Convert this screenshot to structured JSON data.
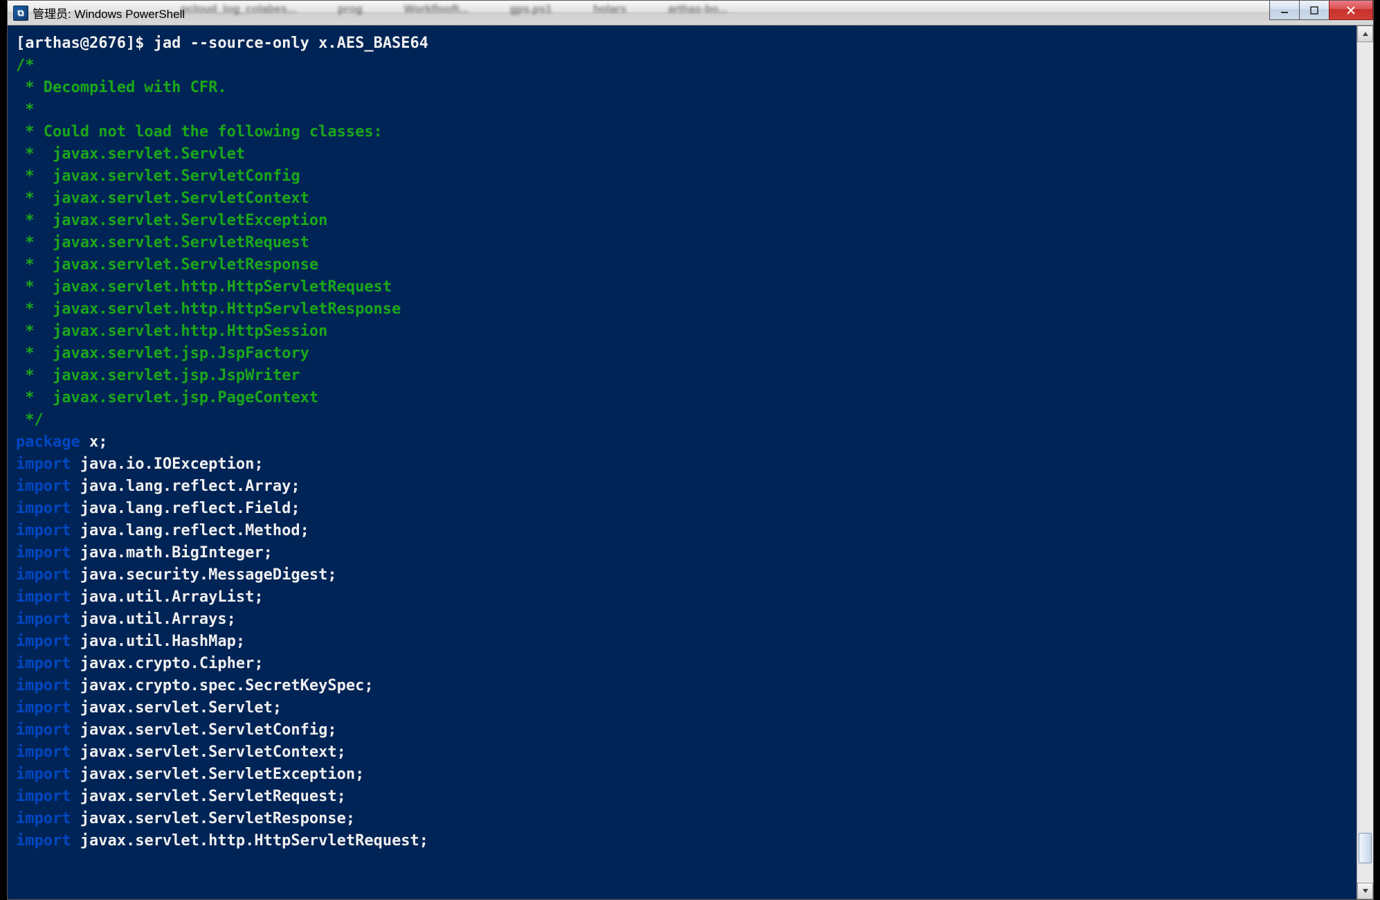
{
  "window": {
    "title": "管理员: Windows PowerShell",
    "icon_glyph": "⧉"
  },
  "prompt": {
    "text": "[arthas@2676]$ ",
    "command": "jad --source-only x.AES_BASE64"
  },
  "comment_block": [
    "/*",
    " * Decompiled with CFR.",
    " *",
    " * Could not load the following classes:",
    " *  javax.servlet.Servlet",
    " *  javax.servlet.ServletConfig",
    " *  javax.servlet.ServletContext",
    " *  javax.servlet.ServletException",
    " *  javax.servlet.ServletRequest",
    " *  javax.servlet.ServletResponse",
    " *  javax.servlet.http.HttpServletRequest",
    " *  javax.servlet.http.HttpServletResponse",
    " *  javax.servlet.http.HttpSession",
    " *  javax.servlet.jsp.JspFactory",
    " *  javax.servlet.jsp.JspWriter",
    " *  javax.servlet.jsp.PageContext",
    " */"
  ],
  "package_line": {
    "keyword": "package",
    "rest": " x;"
  },
  "imports": [
    "java.io.IOException;",
    "java.lang.reflect.Array;",
    "java.lang.reflect.Field;",
    "java.lang.reflect.Method;",
    "java.math.BigInteger;",
    "java.security.MessageDigest;",
    "java.util.ArrayList;",
    "java.util.Arrays;",
    "java.util.HashMap;",
    "javax.crypto.Cipher;",
    "javax.crypto.spec.SecretKeySpec;",
    "javax.servlet.Servlet;",
    "javax.servlet.ServletConfig;",
    "javax.servlet.ServletContext;",
    "javax.servlet.ServletException;",
    "javax.servlet.ServletRequest;",
    "javax.servlet.ServletResponse;",
    "javax.servlet.http.HttpServletRequest;"
  ],
  "import_keyword": "import",
  "taskbar_hints": [
    "pcloud_log_colabes...",
    "prog",
    "Workflooft...",
    "gps.ps1",
    "holars",
    "arthas-bo..."
  ]
}
